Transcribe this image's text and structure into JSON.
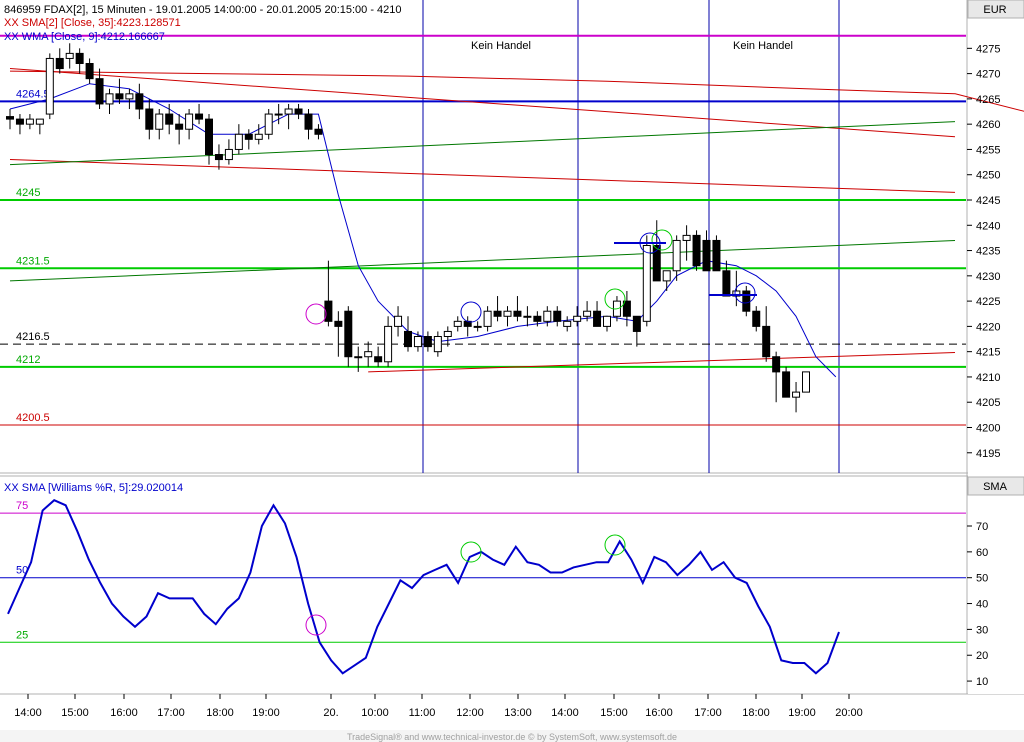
{
  "chart_data": [
    {
      "type": "candlestick",
      "title": "846959  FDAX[2], 15 Minuten - 19.01.2005 14:00:00 - 20.01.2005 20:15:00 - 4210",
      "legend": [
        "XX SMA[2] [Close, 35]:4223.128571",
        "XX WMA [Close, 9]:4212.166667"
      ],
      "currency": "EUR",
      "ylim": [
        4191,
        4281
      ],
      "y_ticks": [
        "4275",
        "4270",
        "4265",
        "4260",
        "4255",
        "4250",
        "4245",
        "4240",
        "4235",
        "4230",
        "4225",
        "4220",
        "4215",
        "4210",
        "4205",
        "4200",
        "4195"
      ],
      "levels": [
        {
          "label": "4264.5",
          "value": 4264.5,
          "color": "#0000cc"
        },
        {
          "label": "4245",
          "value": 4245,
          "color": "#00cc00"
        },
        {
          "label": "4231.5",
          "value": 4231.5,
          "color": "#00cc00"
        },
        {
          "label": "4216.5",
          "value": 4216.5,
          "color": "#000000"
        },
        {
          "label": "4212",
          "value": 4212,
          "color": "#00cc00"
        },
        {
          "label": "4200.5",
          "value": 4200.5,
          "color": "#cc0000"
        }
      ],
      "top_level": 4277.5,
      "annotations": [
        "Kein Handel",
        "Kein Handel"
      ],
      "x_ticks": [
        "14:00",
        "15:00",
        "16:00",
        "17:00",
        "18:00",
        "19:00",
        "20.",
        "10:00",
        "11:00",
        "12:00",
        "13:00",
        "14:00",
        "15:00",
        "16:00",
        "17:00",
        "18:00",
        "19:00",
        "20:00"
      ],
      "candles": [
        [
          4261.5,
          4263,
          4259,
          4261
        ],
        [
          4261,
          4262,
          4258,
          4260
        ],
        [
          4260,
          4262,
          4259,
          4261
        ],
        [
          4260,
          4261,
          4258,
          4261
        ],
        [
          4262,
          4274,
          4261,
          4273
        ],
        [
          4273,
          4275,
          4270,
          4271
        ],
        [
          4273,
          4276,
          4271,
          4274
        ],
        [
          4274,
          4275,
          4270,
          4272
        ],
        [
          4272,
          4273,
          4268,
          4269
        ],
        [
          4269,
          4271,
          4263,
          4264
        ],
        [
          4264,
          4267,
          4262,
          4266
        ],
        [
          4266,
          4269,
          4264,
          4265
        ],
        [
          4265,
          4267,
          4263,
          4266
        ],
        [
          4266,
          4268,
          4261,
          4263
        ],
        [
          4263,
          4265,
          4257,
          4259
        ],
        [
          4259,
          4263,
          4257,
          4262
        ],
        [
          4262,
          4264,
          4258,
          4260
        ],
        [
          4260,
          4262,
          4256,
          4259
        ],
        [
          4259,
          4263,
          4257,
          4262
        ],
        [
          4262,
          4264,
          4260,
          4261
        ],
        [
          4261,
          4262,
          4252,
          4254
        ],
        [
          4254,
          4256,
          4251,
          4253
        ],
        [
          4253,
          4257,
          4252,
          4255
        ],
        [
          4255,
          4260,
          4254,
          4258
        ],
        [
          4258,
          4259,
          4255,
          4257
        ],
        [
          4257,
          4260,
          4256,
          4258
        ],
        [
          4258,
          4263,
          4257,
          4262
        ],
        [
          4262,
          4264,
          4260,
          4262
        ],
        [
          4262,
          4264,
          4259,
          4263
        ],
        [
          4263,
          4264,
          4261,
          4262
        ],
        [
          4262,
          4263,
          4257,
          4259
        ],
        [
          4259,
          4260,
          4257,
          4258
        ],
        [
          4225,
          4233,
          4220,
          4221
        ],
        [
          4221,
          4223,
          4214,
          4220
        ],
        [
          4223,
          4224,
          4212,
          4214
        ],
        [
          4214,
          4216,
          4211,
          4214
        ],
        [
          4214,
          4217,
          4212,
          4215
        ],
        [
          4214,
          4216,
          4212,
          4213
        ],
        [
          4213,
          4222,
          4212,
          4220
        ],
        [
          4220,
          4224,
          4218,
          4222
        ],
        [
          4219,
          4222,
          4215,
          4216
        ],
        [
          4216,
          4219,
          4215,
          4218
        ],
        [
          4218,
          4219,
          4215,
          4216
        ],
        [
          4215,
          4219,
          4214,
          4218
        ],
        [
          4218,
          4220,
          4216,
          4219
        ],
        [
          4220,
          4222,
          4219,
          4221
        ],
        [
          4221,
          4222,
          4218,
          4220
        ],
        [
          4220,
          4221,
          4219,
          4220
        ],
        [
          4220,
          4224,
          4219,
          4223
        ],
        [
          4223,
          4226,
          4221,
          4222
        ],
        [
          4222,
          4224,
          4220,
          4223
        ],
        [
          4223,
          4226,
          4221,
          4222
        ],
        [
          4222,
          4224,
          4220,
          4222
        ],
        [
          4222,
          4223,
          4220,
          4221
        ],
        [
          4221,
          4224,
          4220,
          4223
        ],
        [
          4223,
          4224,
          4220,
          4221
        ],
        [
          4220,
          4222,
          4219,
          4221
        ],
        [
          4221,
          4224,
          4220,
          4222
        ],
        [
          4222,
          4225,
          4221,
          4223
        ],
        [
          4223,
          4225,
          4220,
          4220
        ],
        [
          4220,
          4222,
          4219,
          4222
        ],
        [
          4222,
          4226,
          4221,
          4225
        ],
        [
          4225,
          4227,
          4220,
          4222
        ],
        [
          4222,
          4222,
          4216,
          4219
        ],
        [
          4221,
          4238,
          4220,
          4236
        ],
        [
          4236,
          4241,
          4229,
          4229
        ],
        [
          4229,
          4231,
          4227,
          4231
        ],
        [
          4231,
          4238,
          4229,
          4237
        ],
        [
          4237,
          4240,
          4233,
          4238
        ],
        [
          4238,
          4239,
          4231,
          4232
        ],
        [
          4237,
          4239,
          4231,
          4231
        ],
        [
          4237,
          4238,
          4231,
          4231
        ],
        [
          4231,
          4233,
          4226,
          4226
        ],
        [
          4226,
          4231,
          4224,
          4227
        ],
        [
          4227,
          4228,
          4222,
          4223
        ],
        [
          4223,
          4224,
          4219,
          4220
        ],
        [
          4220,
          4224,
          4213,
          4214
        ],
        [
          4214,
          4215,
          4205,
          4211
        ],
        [
          4211,
          4212,
          4206,
          4206
        ],
        [
          4206,
          4209,
          4203,
          4207
        ],
        [
          4207,
          4211,
          4207,
          4211
        ]
      ],
      "sma35": [
        [
          0,
          4270.5
        ],
        [
          20,
          4270
        ],
        [
          40,
          4269.5
        ],
        [
          60,
          4268.5
        ],
        [
          80,
          4267
        ],
        [
          95,
          4266
        ],
        [
          105,
          4261
        ],
        [
          113,
          4255
        ],
        [
          121,
          4249
        ],
        [
          127,
          4244
        ],
        [
          131,
          4240
        ],
        [
          133,
          4238.5
        ],
        [
          135,
          4237
        ],
        [
          142,
          4231
        ],
        [
          149,
          4226
        ],
        [
          154,
          4224
        ],
        [
          160,
          4223.5
        ]
      ],
      "wma9": [
        [
          0,
          4263
        ],
        [
          4,
          4265
        ],
        [
          8,
          4268
        ],
        [
          12,
          4267
        ],
        [
          16,
          4263
        ],
        [
          20,
          4258
        ],
        [
          24,
          4258
        ],
        [
          28,
          4262
        ],
        [
          31,
          4262
        ],
        [
          33,
          4246
        ],
        [
          35,
          4232
        ],
        [
          37,
          4225
        ],
        [
          40,
          4219
        ],
        [
          43,
          4217
        ],
        [
          47,
          4218
        ],
        [
          51,
          4220
        ],
        [
          55,
          4221
        ],
        [
          60,
          4222
        ],
        [
          63,
          4221
        ],
        [
          65,
          4225
        ],
        [
          67,
          4230
        ],
        [
          70,
          4233
        ],
        [
          73,
          4232
        ],
        [
          75,
          4230
        ],
        [
          77,
          4227
        ],
        [
          79,
          4222
        ],
        [
          81,
          4214
        ],
        [
          83,
          4210
        ]
      ],
      "trendlines": [
        {
          "color": "#cc0000",
          "points": [
            [
              0,
              4271
            ],
            [
              190,
              4244
            ]
          ]
        },
        {
          "color": "#cc0000",
          "points": [
            [
              0,
              4253
            ],
            [
              190,
              4240
            ]
          ]
        },
        {
          "color": "#007700",
          "points": [
            [
              0,
              4252
            ],
            [
              190,
              4269
            ]
          ]
        },
        {
          "color": "#007700",
          "points": [
            [
              0,
              4229
            ],
            [
              190,
              4245
            ]
          ]
        },
        {
          "color": "#cc0000",
          "points": [
            [
              36,
              4211
            ],
            [
              190,
              4221
            ]
          ]
        }
      ]
    },
    {
      "type": "line",
      "title": "XX SMA [Williams %R, 5]:29.020014",
      "label": "SMA",
      "ylim": [
        5,
        82
      ],
      "y_ticks": [
        "70",
        "60",
        "50",
        "40",
        "30",
        "20",
        "10"
      ],
      "levels": [
        {
          "label": "75",
          "value": 75,
          "color": "#cc00cc"
        },
        {
          "label": "50",
          "value": 50,
          "color": "#0000cc"
        },
        {
          "label": "25",
          "value": 25,
          "color": "#00cc00"
        }
      ],
      "series": [
        {
          "values": [
            36,
            46,
            56,
            76,
            80,
            78,
            68,
            57,
            48,
            40,
            35,
            31,
            35,
            44,
            42,
            42,
            42,
            36,
            32,
            38,
            42,
            52,
            70,
            78,
            71,
            58,
            40,
            25,
            18,
            13,
            16,
            19,
            31,
            40,
            49,
            46,
            51,
            53,
            55,
            48,
            58,
            60,
            57,
            55,
            62,
            56,
            55,
            52,
            52,
            54,
            55,
            56,
            56,
            64,
            57,
            48,
            58,
            56,
            51,
            55,
            60,
            53,
            56,
            50,
            48,
            39,
            31,
            18,
            17,
            17,
            13,
            17,
            29
          ]
        }
      ],
      "footer": "TradeSignal® and www.technical-investor.de © by SystemSoft, www.systemsoft.de"
    }
  ]
}
